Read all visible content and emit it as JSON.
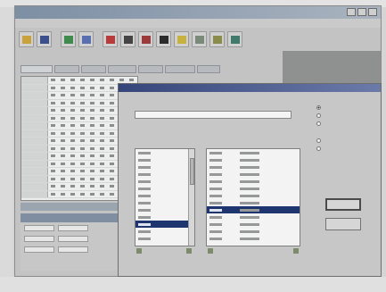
{
  "toolbar": {
    "icons": [
      "open-folder-icon",
      "save-disk-icon",
      "chart-icon",
      "edit-icon",
      "tool-icon",
      "print-icon",
      "table-icon",
      "link-icon",
      "filter-icon",
      "sort-icon",
      "calc-icon",
      "help-icon"
    ]
  },
  "lists": {
    "left_visible_rows": 13,
    "right_visible_rows": 13
  },
  "radios": [
    {
      "state": "on"
    },
    {
      "state": "off"
    },
    {
      "state": "off"
    },
    {
      "state": "off"
    },
    {
      "state": "off"
    }
  ],
  "colors": {
    "selection": "#1f3570",
    "dialog_title": "#36467a",
    "window_title": "#7d8fa4"
  }
}
